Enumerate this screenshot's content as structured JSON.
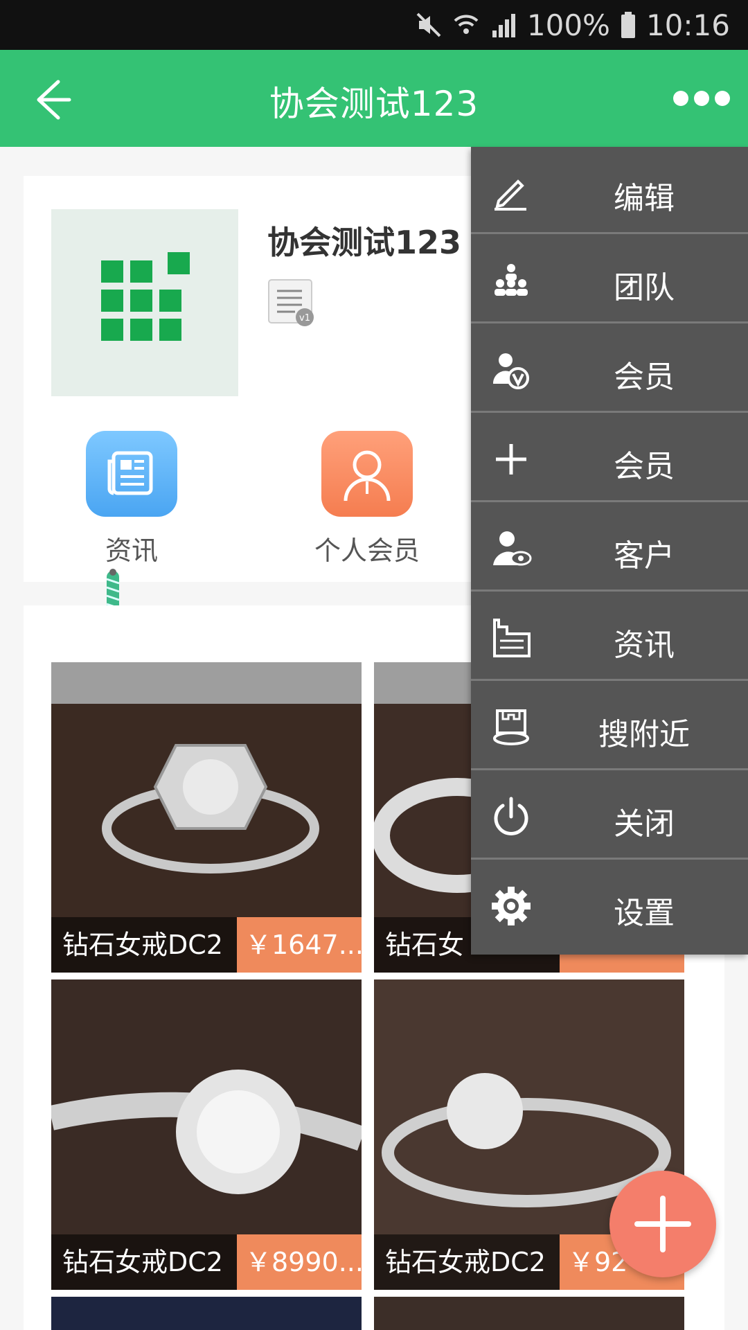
{
  "status_bar": {
    "battery": "100%",
    "time": "10:16"
  },
  "app_bar": {
    "title": "协会测试123"
  },
  "profile": {
    "name": "协会测试123",
    "shortcuts": [
      {
        "label": "资讯",
        "icon": "newspaper-icon"
      },
      {
        "label": "个人会员",
        "icon": "person-icon"
      }
    ]
  },
  "products": [
    {
      "name": "钻石女戒DC2",
      "price": "￥1647..."
    },
    {
      "name": "钻石女",
      "price": ""
    },
    {
      "name": "钻石女戒DC2",
      "price": "￥8990...."
    },
    {
      "name": "钻石女戒DC2",
      "price": "￥92"
    }
  ],
  "menu": {
    "items": [
      {
        "label": "编辑",
        "icon": "pencil-icon"
      },
      {
        "label": "团队",
        "icon": "team-icon"
      },
      {
        "label": "会员",
        "icon": "vip-member-icon"
      },
      {
        "label": "会员",
        "icon": "plus-icon"
      },
      {
        "label": "客户",
        "icon": "customer-icon"
      },
      {
        "label": "资讯",
        "icon": "news-icon"
      },
      {
        "label": "搜附近",
        "icon": "nearby-icon"
      },
      {
        "label": "关闭",
        "icon": "power-icon"
      },
      {
        "label": "设置",
        "icon": "gear-icon"
      }
    ]
  },
  "colors": {
    "primary": "#34c274",
    "menu_bg": "#555555",
    "price_bg": "#ef8a5c",
    "fab": "#f47e6b"
  }
}
